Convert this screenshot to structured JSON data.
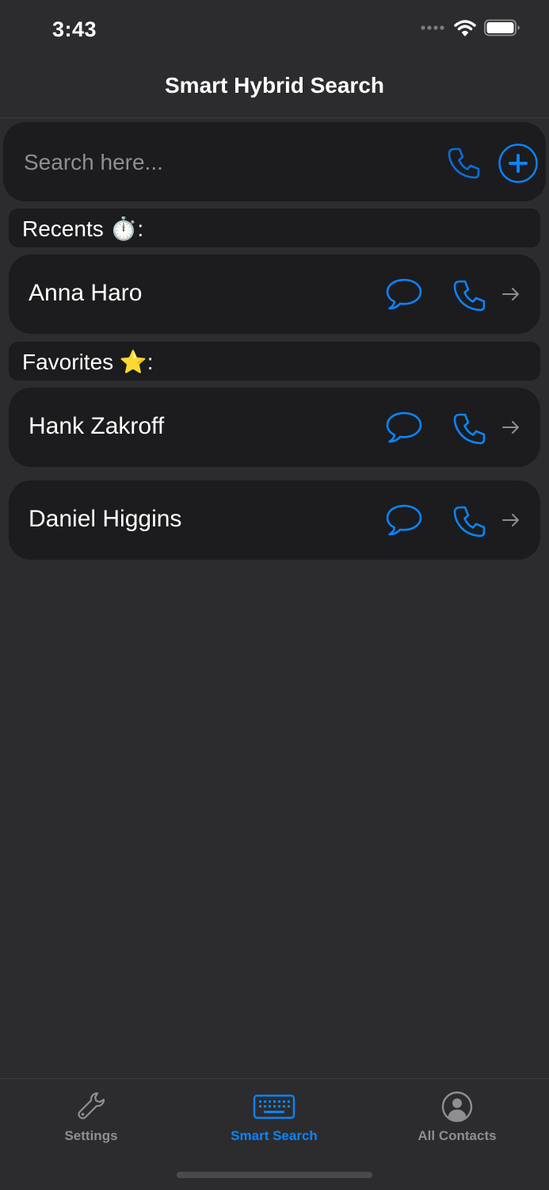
{
  "status_bar": {
    "time": "3:43"
  },
  "nav": {
    "title": "Smart Hybrid Search"
  },
  "search": {
    "placeholder": "Search here...",
    "value": "",
    "phone_icon": "phone-icon",
    "add_icon": "plus-circle-icon"
  },
  "sections": {
    "recents": {
      "label": "Recents ⏱️:"
    },
    "favorites": {
      "label": "Favorites ⭐️:"
    }
  },
  "contacts": {
    "recents": [
      {
        "name": "Anna Haro"
      }
    ],
    "favorites": [
      {
        "name": "Hank Zakroff"
      },
      {
        "name": "Daniel Higgins"
      }
    ]
  },
  "tabs": [
    {
      "label": "Settings",
      "icon": "wrench-icon",
      "active": false
    },
    {
      "label": "Smart Search",
      "icon": "keyboard-icon",
      "active": true
    },
    {
      "label": "All Contacts",
      "icon": "person-circle-icon",
      "active": false
    }
  ],
  "colors": {
    "accent": "#0a84ff",
    "background": "#2c2c2e",
    "card": "#1c1c1e",
    "inactive": "#8e8e93"
  }
}
